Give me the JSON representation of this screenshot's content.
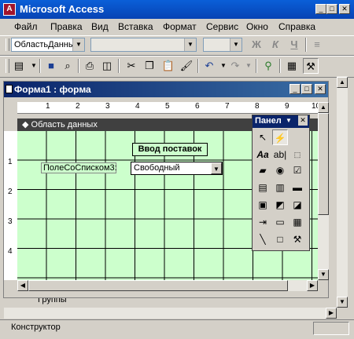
{
  "app": {
    "title": "Microsoft Access",
    "icon_letter": "A"
  },
  "window_controls": {
    "minimize": "_",
    "maximize": "□",
    "close": "✕"
  },
  "menu": [
    "Файл",
    "Правка",
    "Вид",
    "Вставка",
    "Формат",
    "Сервис",
    "Окно",
    "Справка"
  ],
  "format_toolbar": {
    "object_combo_value": "ОбластьДанны",
    "bold": "Ж",
    "italic": "К",
    "underline": "Ч"
  },
  "form_window": {
    "title": "Форма1 : форма",
    "section_title": "Область данных",
    "heading_label": "Ввод поставок",
    "field_label": "ПолеСоСписком3:",
    "combo_value": "Свободный",
    "hidden_text": "Группы"
  },
  "ruler": {
    "h": [
      "1",
      "2",
      "3",
      "4",
      "5",
      "6",
      "7",
      "8",
      "9",
      "10"
    ],
    "v": [
      "1",
      "2",
      "3",
      "4"
    ]
  },
  "toolbox": {
    "title": "Панел",
    "tools": [
      "pointer",
      "wizard",
      "Aa",
      "ab|",
      "xyz-group",
      "toggle",
      "radio",
      "check",
      "combo",
      "list",
      "button",
      "image",
      "unbound-frame",
      "bound-frame",
      "page-break",
      "tab",
      "subform",
      "line",
      "rectangle",
      "more-tools"
    ]
  },
  "status": {
    "text": "Конструктор"
  },
  "colors": {
    "grid_bg": "#ccffcc",
    "title_blue": "#0a5fd8",
    "form_title": "#0a246a"
  }
}
